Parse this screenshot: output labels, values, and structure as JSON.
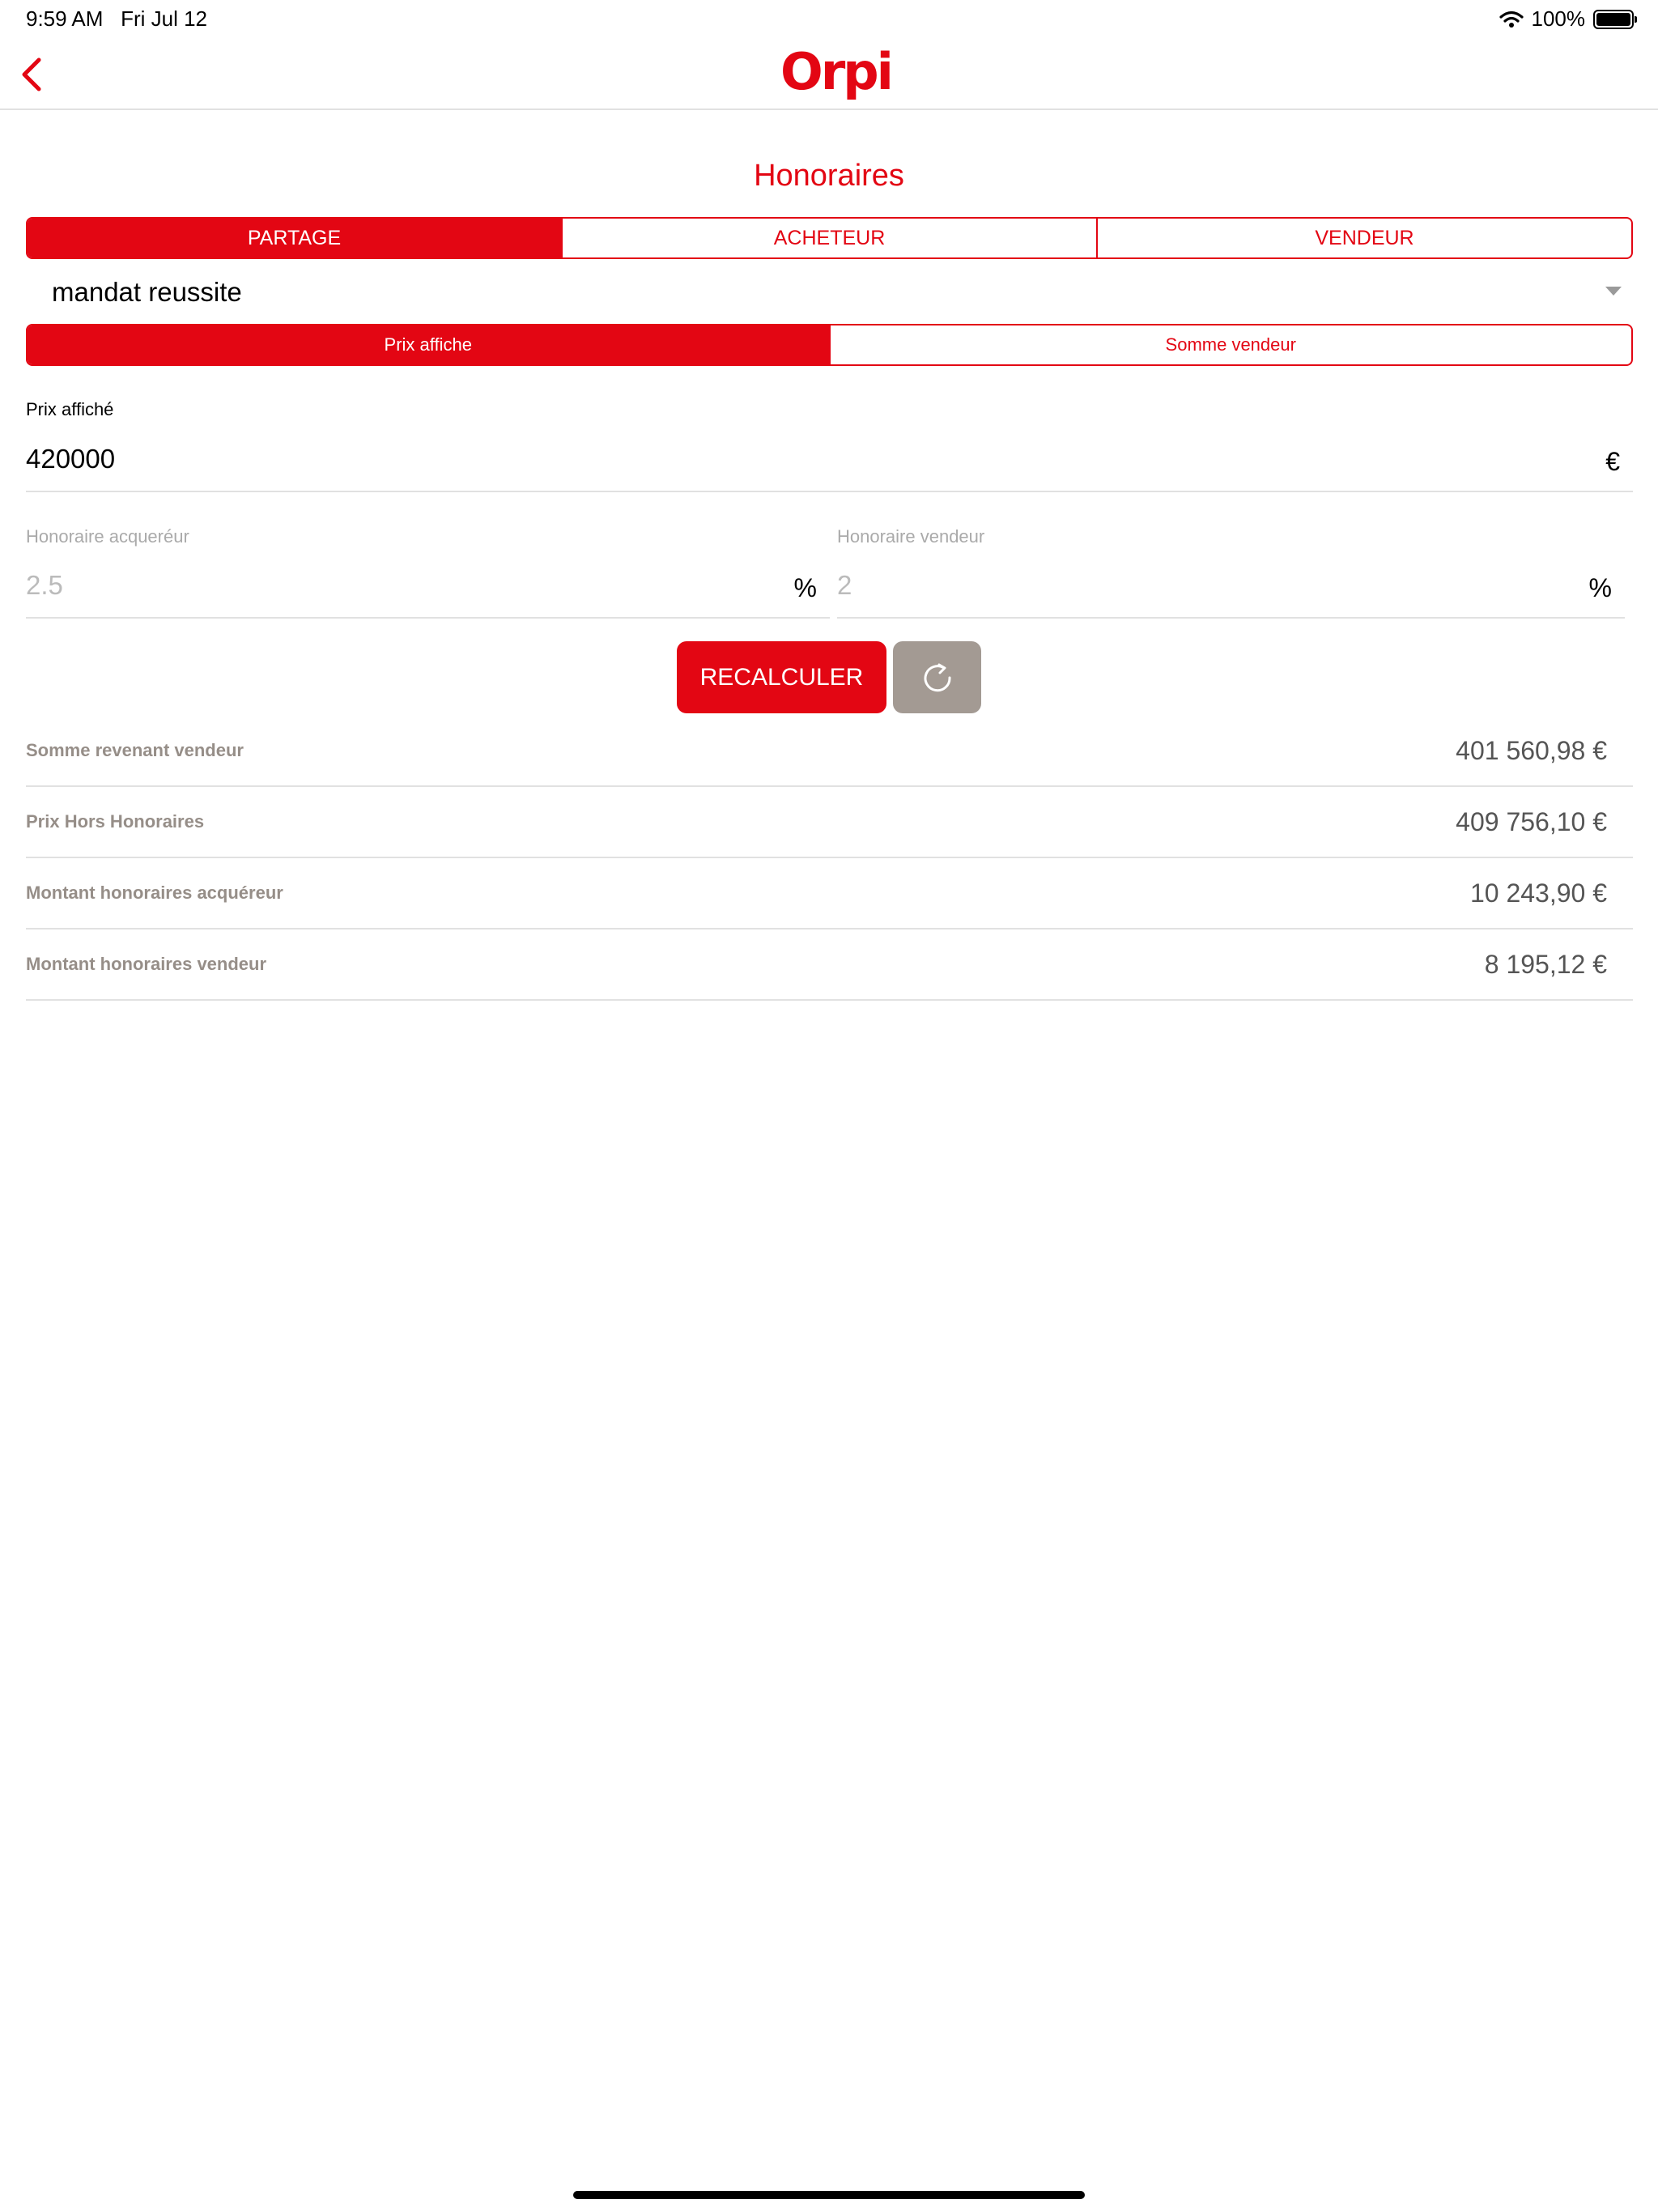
{
  "status": {
    "time": "9:59 AM",
    "date": "Fri Jul 12",
    "battery": "100%",
    "battery_level": 1.0
  },
  "header": {
    "logo": "Orpi",
    "back_icon": "chevron-left-icon"
  },
  "page": {
    "title": "Honoraires"
  },
  "segments": [
    {
      "label": "PARTAGE",
      "active": true
    },
    {
      "label": "ACHETEUR",
      "active": false
    },
    {
      "label": "VENDEUR",
      "active": false
    }
  ],
  "mandat": {
    "value": "mandat reussite"
  },
  "price_mode": [
    {
      "label": "Prix affiche",
      "active": true
    },
    {
      "label": "Somme vendeur",
      "active": false
    }
  ],
  "prix": {
    "label": "Prix affiché",
    "value": "420000",
    "unit": "€"
  },
  "honoraire_acquereur": {
    "label": "Honoraire acqueréur",
    "placeholder": "2.5",
    "unit": "%"
  },
  "honoraire_vendeur": {
    "label": "Honoraire vendeur",
    "placeholder": "2",
    "unit": "%"
  },
  "actions": {
    "recalc_label": "RECALCULER",
    "reset_icon": "refresh-icon"
  },
  "results": [
    {
      "label": "Somme revenant vendeur",
      "value": "401 560,98 €"
    },
    {
      "label": "Prix Hors Honoraires",
      "value": "409 756,10 €"
    },
    {
      "label": "Montant honoraires acquéreur",
      "value": "10 243,90 €"
    },
    {
      "label": "Montant honoraires vendeur",
      "value": "8 195,12 €"
    }
  ],
  "colors": {
    "brand": "#e30613",
    "secondary_button": "#a39a93",
    "result_label": "#968e88"
  }
}
